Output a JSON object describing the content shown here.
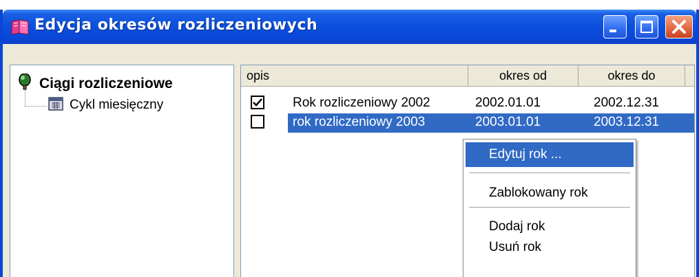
{
  "window": {
    "title": "Edycja okresów rozliczeniowych",
    "accent": "#0a46d6"
  },
  "tree": {
    "root_label": "Ciągi rozliczeniowe",
    "child_label": "Cykl miesięczny"
  },
  "list": {
    "columns": [
      "opis",
      "okres od",
      "okres do"
    ],
    "rows": [
      {
        "checked": true,
        "opis": "Rok rozliczeniowy 2002",
        "od": "2002.01.01",
        "do": "2002.12.31",
        "selected": false
      },
      {
        "checked": false,
        "opis": "rok rozliczeniowy 2003",
        "od": "2003.01.01",
        "do": "2003.12.31",
        "selected": true
      }
    ],
    "selection_color": "#316ac5"
  },
  "context_menu": {
    "items": [
      "Edytuj rok ...",
      "Zablokowany rok",
      "Dodaj rok",
      "Usuń rok"
    ]
  },
  "icons": {
    "app": "book-icon",
    "tree_root": "pin-icon",
    "tree_child": "calendar-icon"
  }
}
